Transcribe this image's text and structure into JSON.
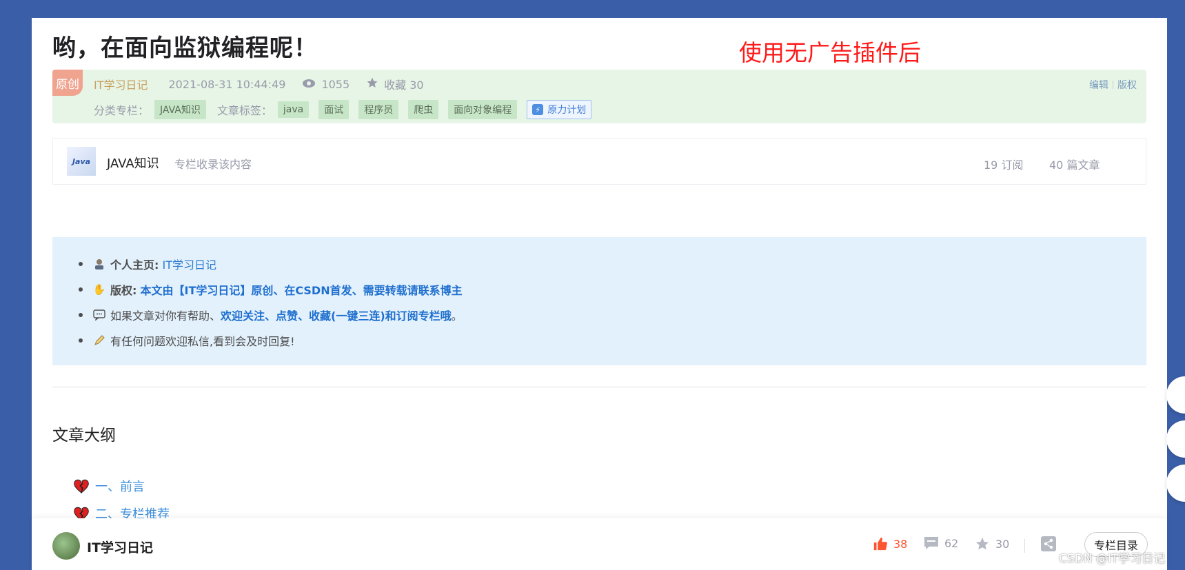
{
  "title": "哟，在面向监狱编程呢！",
  "annotation": "使用无广告插件后",
  "meta": {
    "badge": "原创",
    "author": "IT学习日记",
    "date": "2021-08-31 10:44:49",
    "views": "1055",
    "favorites": "收藏 30",
    "edit": "编辑",
    "copyright": "版权",
    "category_label": "分类专栏：",
    "category_tag": "JAVA知识",
    "tags_label": "文章标签：",
    "tags": [
      "java",
      "面试",
      "程序员",
      "爬虫",
      "面向对象编程"
    ],
    "plan": "原力计划"
  },
  "column": {
    "thumb_text": "Java",
    "name": "JAVA知识",
    "desc": "专栏收录该内容",
    "subscriptions": "19 订阅",
    "articles": "40 篇文章"
  },
  "info": {
    "item1_label": "个人主页:",
    "item1_value": "IT学习日记",
    "item2_label": "版权:",
    "item2_value": "本文由【IT学习日记】原创、在CSDN首发、需要转载请联系博主",
    "item3_text": "如果文章对你有帮助、",
    "item3_link": "欢迎关注、点赞、收藏(一键三连)和订阅专栏哦",
    "item3_end": "。",
    "item4_text": "有任何问题欢迎私信,看到会及时回复!"
  },
  "outline": {
    "title": "文章大纲",
    "items": [
      "一、前言",
      "二、专栏推荐"
    ]
  },
  "bottom": {
    "author": "IT学习日记",
    "likes": "38",
    "comments": "62",
    "favorites": "30",
    "column_button": "专栏目录"
  },
  "watermark": "CSDN @IT学习日记",
  "colors": {
    "background": "#3a5ea8",
    "meta_box": "#e6f5e6",
    "info_box": "#e3f1fc",
    "like_accent": "#fc5531",
    "link": "#3a8ddc",
    "annotation": "#ff1a1a"
  }
}
